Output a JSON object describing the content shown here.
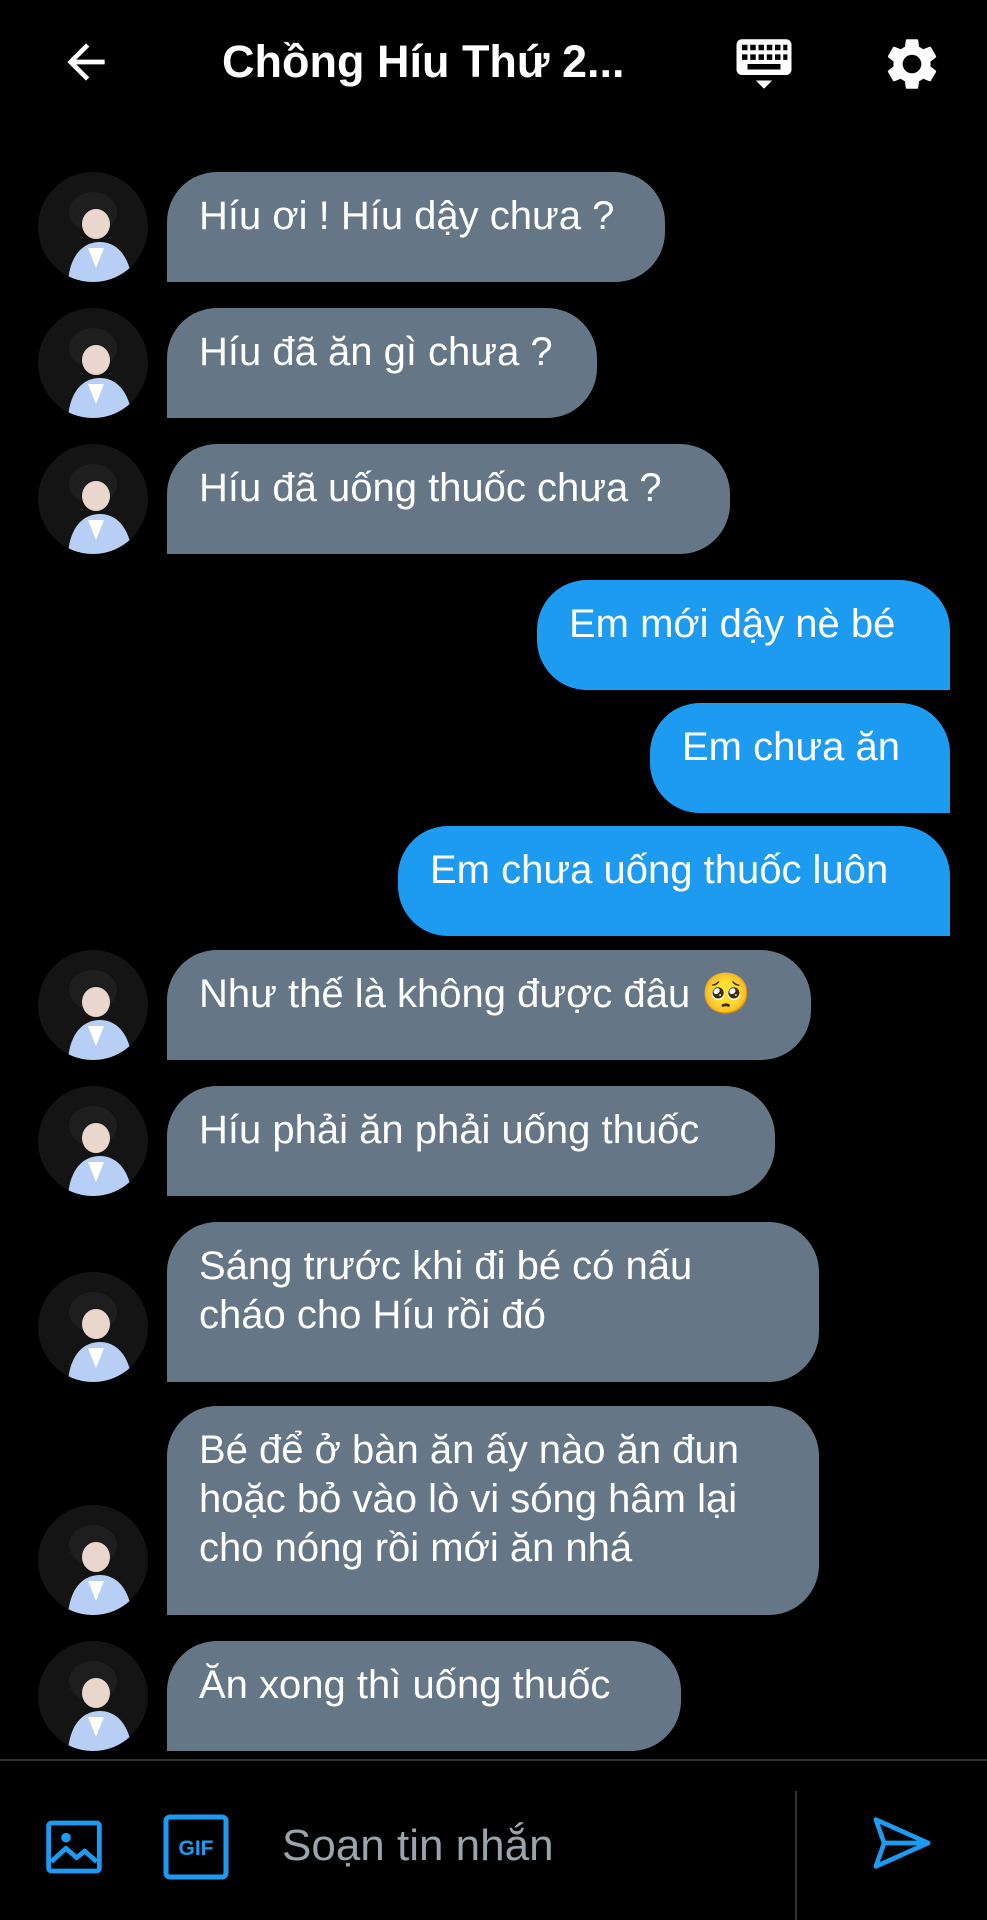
{
  "header": {
    "title": "Chồng Híu Thứ 2..."
  },
  "messages": [
    {
      "dir": "in",
      "text": "Híu ơi ! Híu dậy chưa ?"
    },
    {
      "dir": "in",
      "text": "Híu đã ăn gì chưa ?"
    },
    {
      "dir": "in",
      "text": "Híu đã uống thuốc chưa ?"
    },
    {
      "dir": "out",
      "text": "Em mới dậy nè bé"
    },
    {
      "dir": "out",
      "text": "Em chưa ăn"
    },
    {
      "dir": "out",
      "text": "Em chưa uống thuốc luôn"
    },
    {
      "dir": "in",
      "text": "Như thế là không được đâu 🥺"
    },
    {
      "dir": "in",
      "text": "Híu phải ăn phải uống thuốc"
    },
    {
      "dir": "in",
      "text": "Sáng trước khi đi bé có nấu cháo cho Híu rồi đó"
    },
    {
      "dir": "in",
      "text": "Bé để ở bàn ăn ấy nào ăn đun hoặc bỏ vào lò vi sóng hâm lại cho nóng rồi mới ăn nhá"
    },
    {
      "dir": "in",
      "text": "Ăn xong thì uống thuốc"
    }
  ],
  "composer": {
    "placeholder": "Soạn tin nhắn",
    "gif_label": "GIF"
  },
  "icons": {
    "back": "arrow-left-icon",
    "keyboard": "keyboard-icon",
    "settings": "gear-icon",
    "image": "image-icon",
    "gif": "gif-icon",
    "send": "send-icon"
  },
  "colors": {
    "background": "#000000",
    "incoming_bubble": "#657786",
    "outgoing_bubble": "#1d9bf0",
    "accent": "#1d9bf0",
    "text": "#ffffff"
  }
}
